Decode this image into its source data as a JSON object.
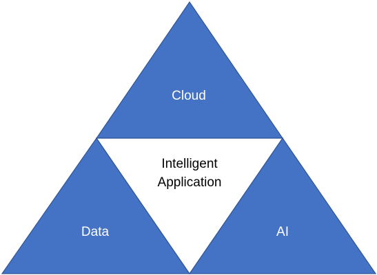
{
  "diagram": {
    "top": "Cloud",
    "left": "Data",
    "right": "AI",
    "center_line1": "Intelligent",
    "center_line2": "Application"
  },
  "colors": {
    "segment_fill": "#4472c4",
    "segment_border": "#2f5597",
    "center_fill": "#ffffff"
  }
}
